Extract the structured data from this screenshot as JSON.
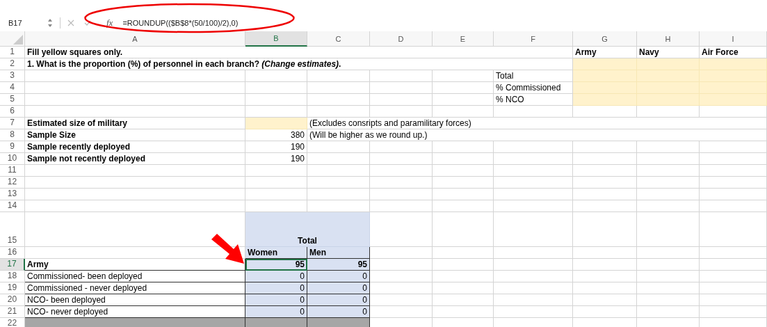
{
  "formula_bar": {
    "name_box": "B17",
    "function_label": "fx",
    "formula": "=ROUNDUP(($B$8*(50/100)/2),0)"
  },
  "columns": [
    {
      "label": "A",
      "selected": false
    },
    {
      "label": "B",
      "selected": true
    },
    {
      "label": "C",
      "selected": false
    },
    {
      "label": "D",
      "selected": false
    },
    {
      "label": "E",
      "selected": false
    },
    {
      "label": "F",
      "selected": false
    },
    {
      "label": "G",
      "selected": false
    },
    {
      "label": "H",
      "selected": false
    },
    {
      "label": "I",
      "selected": false
    }
  ],
  "rows": [
    {
      "label": "1",
      "kind": "normal",
      "selected": false,
      "cells": [
        {
          "text": "Fill yellow squares only.",
          "bold": true
        },
        {},
        {},
        {},
        {},
        {},
        {
          "text": "Army",
          "bold": true
        },
        {
          "text": "Navy",
          "bold": true
        },
        {
          "text": "Air Force",
          "bold": true
        }
      ]
    },
    {
      "label": "2",
      "kind": "normal",
      "selected": false,
      "cells": [
        {
          "text": "1. What is the proportion (%) of personnel in each branch? *(Change estimates)*.",
          "bold": true
        },
        {},
        {},
        {},
        {},
        {},
        {
          "kind": "input"
        },
        {
          "kind": "input"
        },
        {
          "kind": "input"
        }
      ]
    },
    {
      "label": "3",
      "kind": "normal",
      "selected": false,
      "cells": [
        {},
        {},
        {},
        {},
        {},
        {
          "text": "Total"
        },
        {
          "kind": "input"
        },
        {
          "kind": "input"
        },
        {
          "kind": "input"
        }
      ]
    },
    {
      "label": "4",
      "kind": "normal",
      "selected": false,
      "cells": [
        {},
        {},
        {},
        {},
        {},
        {
          "text": "% Commissioned"
        },
        {
          "kind": "input"
        },
        {
          "kind": "input"
        },
        {
          "kind": "input"
        }
      ]
    },
    {
      "label": "5",
      "kind": "normal",
      "selected": false,
      "cells": [
        {},
        {},
        {},
        {},
        {},
        {
          "text": "% NCO"
        },
        {
          "kind": "input"
        },
        {
          "kind": "input"
        },
        {
          "kind": "input"
        }
      ]
    },
    {
      "label": "6",
      "kind": "normal",
      "selected": false
    },
    {
      "label": "7",
      "kind": "normal",
      "selected": false,
      "cells": [
        {
          "text": "Estimated size of military",
          "bold": true
        },
        {
          "kind": "input"
        },
        {
          "text": "(Excludes consripts and paramilitary forces)"
        }
      ]
    },
    {
      "label": "8",
      "kind": "normal",
      "selected": false,
      "cells": [
        {
          "text": "Sample Size",
          "bold": true
        },
        {
          "text": "380",
          "right_aligned": true
        },
        {
          "text": "(Will be higher as we round up.)"
        }
      ]
    },
    {
      "label": "9",
      "kind": "normal",
      "selected": false,
      "cells": [
        {
          "text": "Sample recently deployed",
          "bold": true
        },
        {
          "text": "190",
          "right_aligned": true
        }
      ]
    },
    {
      "label": "10",
      "kind": "normal",
      "selected": false,
      "cells": [
        {
          "text": "Sample not recently deployed",
          "bold": true
        },
        {
          "text": "190",
          "right_aligned": true
        }
      ]
    },
    {
      "label": "11",
      "kind": "normal",
      "selected": false
    },
    {
      "label": "12",
      "kind": "normal",
      "selected": false
    },
    {
      "label": "13",
      "kind": "normal",
      "selected": false
    },
    {
      "label": "14",
      "kind": "normal",
      "selected": false
    },
    {
      "label": "15",
      "kind": "tall",
      "selected": false,
      "cells": [
        {},
        {
          "text": "Total",
          "bold": true,
          "centered": true,
          "kind": "table"
        },
        {
          "kind": "table"
        }
      ]
    },
    {
      "label": "16",
      "kind": "normal",
      "selected": false,
      "cells": [
        {},
        {
          "text": "Women",
          "bold": true,
          "kind": "table",
          "boxed": true
        },
        {
          "text": "Men",
          "bold": true,
          "kind": "table",
          "boxed": true
        }
      ]
    },
    {
      "label": "17",
      "kind": "normal",
      "selected": true,
      "cells": [
        {
          "text": "Army",
          "bold": true,
          "boxed": true
        },
        {
          "text": "95",
          "bold": true,
          "right_aligned": true,
          "kind": "table",
          "boxed": true
        },
        {
          "text": "95",
          "bold": true,
          "right_aligned": true,
          "kind": "table",
          "boxed": true
        }
      ]
    },
    {
      "label": "18",
      "kind": "normal",
      "selected": false,
      "cells": [
        {
          "text": "Commissioned- been deployed",
          "boxed": true
        },
        {
          "text": "0",
          "right_aligned": true,
          "kind": "table",
          "boxed": true
        },
        {
          "text": "0",
          "right_aligned": true,
          "kind": "table",
          "boxed": true
        }
      ]
    },
    {
      "label": "19",
      "kind": "normal",
      "selected": false,
      "cells": [
        {
          "text": "Commissioned - never deployed",
          "boxed": true
        },
        {
          "text": "0",
          "right_aligned": true,
          "kind": "table",
          "boxed": true
        },
        {
          "text": "0",
          "right_aligned": true,
          "kind": "table",
          "boxed": true
        }
      ]
    },
    {
      "label": "20",
      "kind": "normal",
      "selected": false,
      "cells": [
        {
          "text": "NCO- been deployed",
          "boxed": true
        },
        {
          "text": "0",
          "right_aligned": true,
          "kind": "table",
          "boxed": true
        },
        {
          "text": "0",
          "right_aligned": true,
          "kind": "table",
          "boxed": true
        }
      ]
    },
    {
      "label": "21",
      "kind": "normal",
      "selected": false,
      "cells": [
        {
          "text": "NCO- never deployed",
          "boxed": true
        },
        {
          "text": "0",
          "right_aligned": true,
          "kind": "table",
          "boxed": true
        },
        {
          "text": "0",
          "right_aligned": true,
          "kind": "table",
          "boxed": true
        }
      ]
    },
    {
      "label": "22",
      "kind": "normal",
      "selected": false,
      "cells": [
        {
          "kind": "total",
          "boxed": true
        },
        {
          "kind": "total",
          "boxed": true
        },
        {
          "kind": "total",
          "boxed": true
        }
      ]
    }
  ]
}
